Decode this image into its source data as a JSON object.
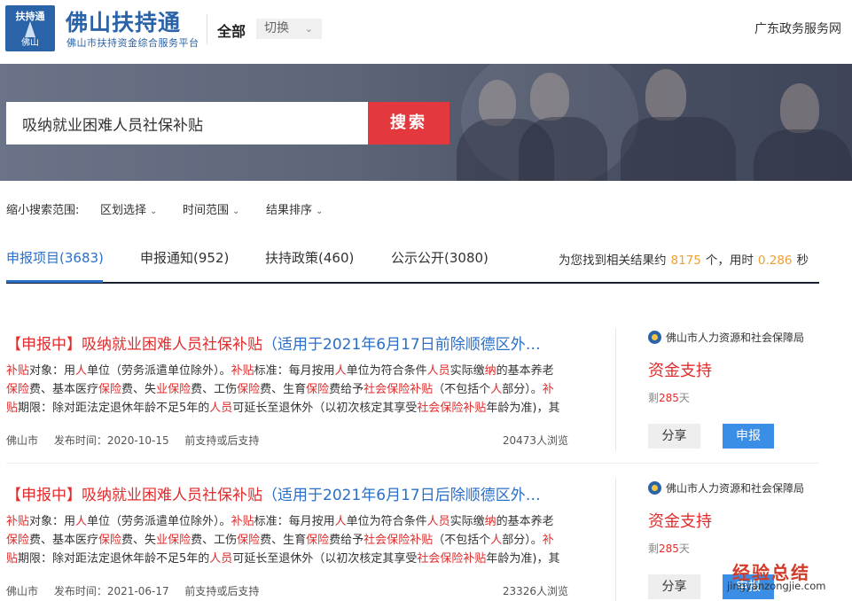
{
  "header": {
    "logo_top": "扶持通",
    "logo_bottom": "佛山",
    "brand_title": "佛山扶持通",
    "brand_subtitle": "佛山市扶持资金综合服务平台",
    "scope": "全部",
    "switch_label": "切换",
    "gov_link": "广东政务服务网"
  },
  "search": {
    "value": "吸纳就业困难人员社保补贴",
    "button_label": "搜索"
  },
  "filters": {
    "label": "缩小搜索范围:",
    "items": [
      "区划选择",
      "时间范围",
      "结果排序"
    ]
  },
  "tabs": [
    {
      "label": "申报项目(3683)",
      "active": true
    },
    {
      "label": "申报通知(952)",
      "active": false
    },
    {
      "label": "扶持政策(460)",
      "active": false
    },
    {
      "label": "公示公开(3080)",
      "active": false
    }
  ],
  "result_info": {
    "prefix": "为您找到相关结果约",
    "count": "8175",
    "middle": "个，用时",
    "time": "0.286",
    "suffix": "秒"
  },
  "results": [
    {
      "status": "【申报中】",
      "title_main": "吸纳就业困难人员社保补贴",
      "title_suffix": "（适用于2021年6月17日前除顺德区外…",
      "desc_lines": [
        [
          {
            "t": "补贴",
            "h": true
          },
          {
            "t": "对象：用",
            "h": false
          },
          {
            "t": "人",
            "h": true
          },
          {
            "t": "单位（劳务派遣单位除外）。",
            "h": false
          },
          {
            "t": "补贴",
            "h": true
          },
          {
            "t": "标准：每月按用",
            "h": false
          },
          {
            "t": "人",
            "h": true
          },
          {
            "t": "单位为符合条件",
            "h": false
          },
          {
            "t": "人员",
            "h": true
          },
          {
            "t": "实际缴",
            "h": false
          },
          {
            "t": "纳",
            "h": true
          },
          {
            "t": "的基本养老",
            "h": false
          }
        ],
        [
          {
            "t": "保险",
            "h": true
          },
          {
            "t": "费、基本医疗",
            "h": false
          },
          {
            "t": "保险",
            "h": true
          },
          {
            "t": "费、失",
            "h": false
          },
          {
            "t": "业",
            "h": true
          },
          {
            "t": "保险",
            "h": true
          },
          {
            "t": "费、工伤",
            "h": false
          },
          {
            "t": "保险",
            "h": true
          },
          {
            "t": "费、生育",
            "h": false
          },
          {
            "t": "保险",
            "h": true
          },
          {
            "t": "费给予",
            "h": false
          },
          {
            "t": "社会",
            "h": true
          },
          {
            "t": "保险",
            "h": true
          },
          {
            "t": "补贴",
            "h": true
          },
          {
            "t": "（不包括个",
            "h": false
          },
          {
            "t": "人",
            "h": true
          },
          {
            "t": "部分）。",
            "h": false
          },
          {
            "t": "补",
            "h": true
          }
        ],
        [
          {
            "t": "贴",
            "h": true
          },
          {
            "t": "期限：除对距法定退休年龄不足5年的",
            "h": false
          },
          {
            "t": "人员",
            "h": true
          },
          {
            "t": "可延长至退休外（以初次核定其享受",
            "h": false
          },
          {
            "t": "社会",
            "h": true
          },
          {
            "t": "保险",
            "h": true
          },
          {
            "t": "补贴",
            "h": true
          },
          {
            "t": "年龄为准)，其",
            "h": false
          }
        ]
      ],
      "region": "佛山市",
      "date": "发布时间：2020-10-15",
      "support_type": "前支持或后支持",
      "views": "20473人浏览",
      "agency": "佛山市人力资源和社会保障局",
      "support": "资金支持",
      "remain_prefix": "剩",
      "remain_days": "285",
      "remain_suffix": "天",
      "share_label": "分享",
      "apply_label": "申报"
    },
    {
      "status": "【申报中】",
      "title_main": "吸纳就业困难人员社保补贴",
      "title_suffix": "（适用于2021年6月17日后除顺德区外…",
      "desc_lines": [
        [
          {
            "t": "补贴",
            "h": true
          },
          {
            "t": "对象：用",
            "h": false
          },
          {
            "t": "人",
            "h": true
          },
          {
            "t": "单位（劳务派遣单位除外）。",
            "h": false
          },
          {
            "t": "补贴",
            "h": true
          },
          {
            "t": "标准：每月按用",
            "h": false
          },
          {
            "t": "人",
            "h": true
          },
          {
            "t": "单位为符合条件",
            "h": false
          },
          {
            "t": "人员",
            "h": true
          },
          {
            "t": "实际缴",
            "h": false
          },
          {
            "t": "纳",
            "h": true
          },
          {
            "t": "的基本养老",
            "h": false
          }
        ],
        [
          {
            "t": "保险",
            "h": true
          },
          {
            "t": "费、基本医疗",
            "h": false
          },
          {
            "t": "保险",
            "h": true
          },
          {
            "t": "费、失",
            "h": false
          },
          {
            "t": "业",
            "h": true
          },
          {
            "t": "保险",
            "h": true
          },
          {
            "t": "费、工伤",
            "h": false
          },
          {
            "t": "保险",
            "h": true
          },
          {
            "t": "费、生育",
            "h": false
          },
          {
            "t": "保险",
            "h": true
          },
          {
            "t": "费给予",
            "h": false
          },
          {
            "t": "社会",
            "h": true
          },
          {
            "t": "保险",
            "h": true
          },
          {
            "t": "补贴",
            "h": true
          },
          {
            "t": "（不包括个",
            "h": false
          },
          {
            "t": "人",
            "h": true
          },
          {
            "t": "部分）。",
            "h": false
          },
          {
            "t": "补",
            "h": true
          }
        ],
        [
          {
            "t": "贴",
            "h": true
          },
          {
            "t": "期限：除对距法定退休年龄不足5年的",
            "h": false
          },
          {
            "t": "人员",
            "h": true
          },
          {
            "t": "可延长至退休外（以初次核定其享受",
            "h": false
          },
          {
            "t": "社会",
            "h": true
          },
          {
            "t": "保险",
            "h": true
          },
          {
            "t": "补贴",
            "h": true
          },
          {
            "t": "年龄为准)，其",
            "h": false
          }
        ]
      ],
      "region": "佛山市",
      "date": "发布时间：2021-06-17",
      "support_type": "前支持或后支持",
      "views": "23326人浏览",
      "agency": "佛山市人力资源和社会保障局",
      "support": "资金支持",
      "remain_prefix": "剩",
      "remain_days": "285",
      "remain_suffix": "天",
      "share_label": "分享",
      "apply_label": "申报"
    }
  ],
  "watermark": {
    "line1": "经验总结",
    "line2": "jingyanzongjie.com"
  }
}
